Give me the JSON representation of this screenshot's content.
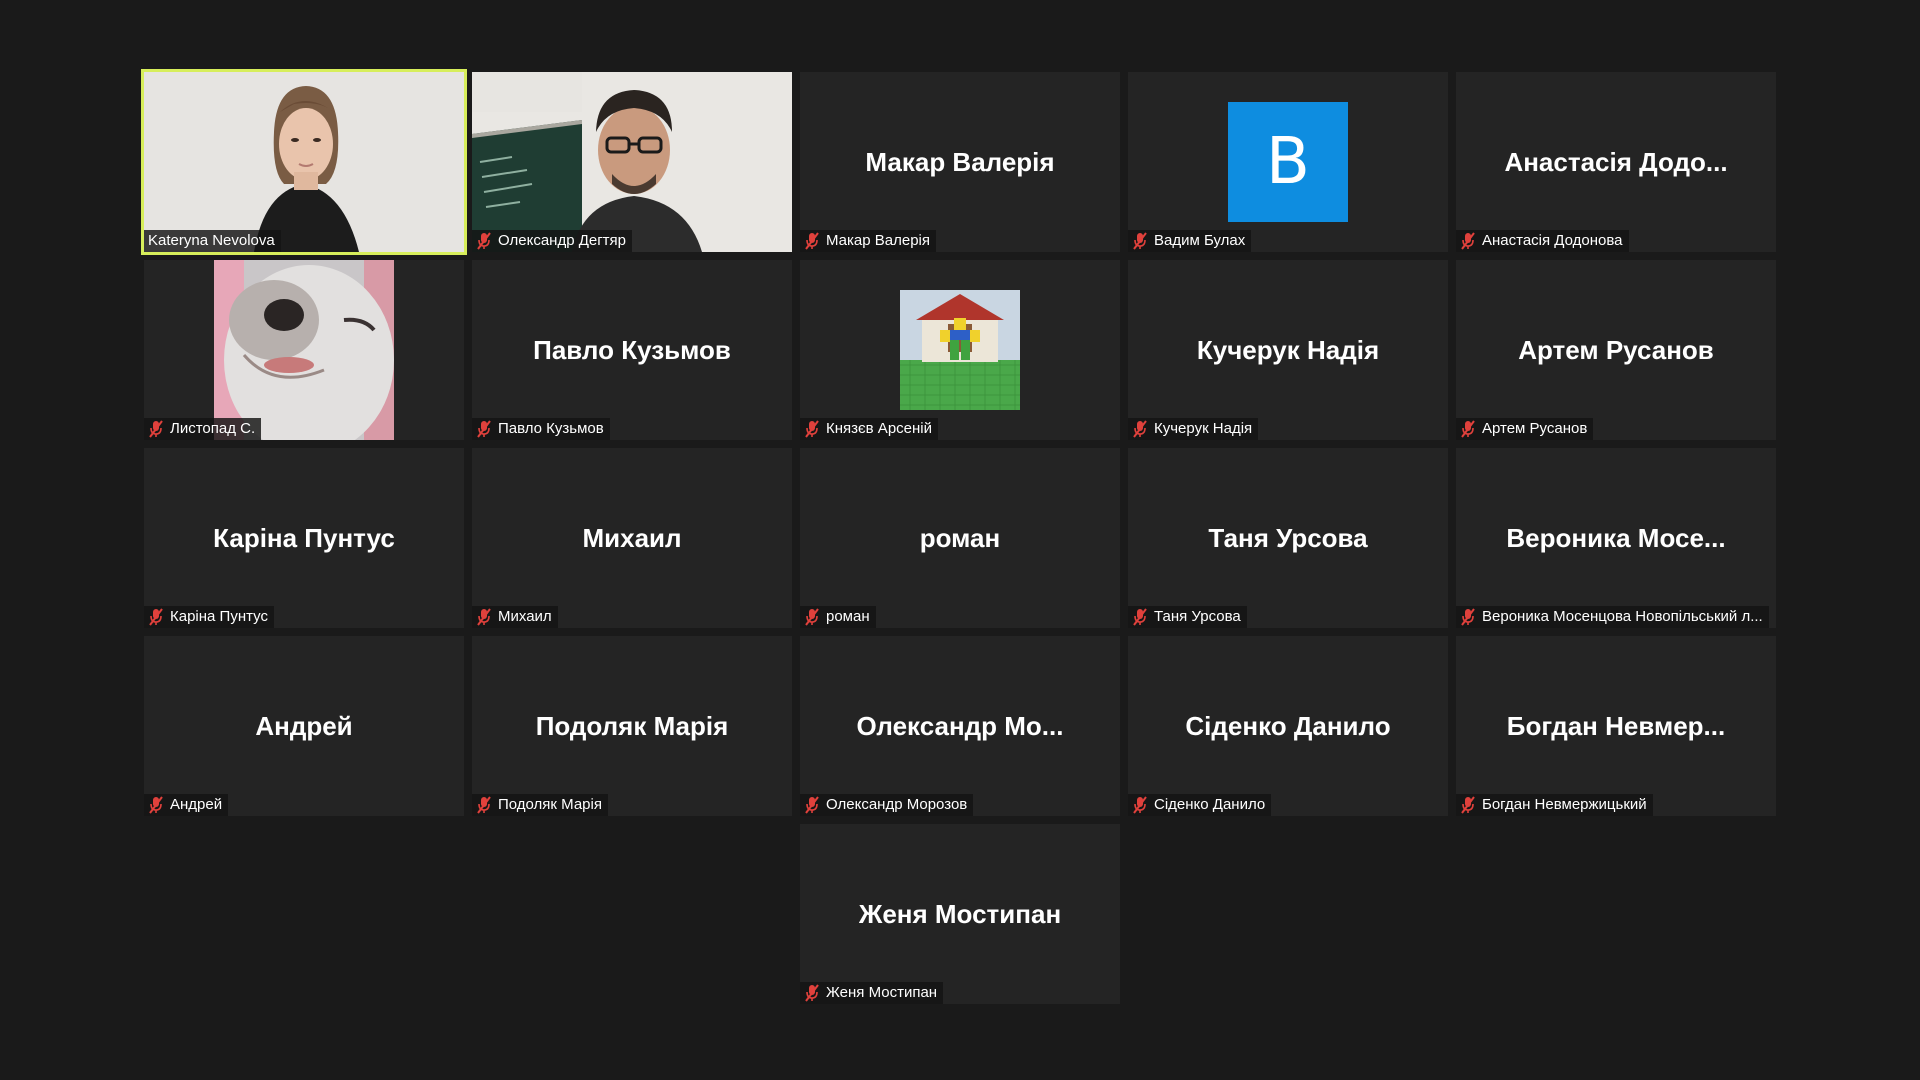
{
  "colors": {
    "background": "#1a1a1a",
    "tile": "#242424",
    "active_speaker_border": "#d7ee5b",
    "avatar_blue": "#0e8de0",
    "mic_off_red": "#e0413c"
  },
  "participants": [
    {
      "tag": "Kateryna Nevolova",
      "center": "",
      "muted": false,
      "video": "camera-woman",
      "active": true
    },
    {
      "tag": "Олександр Дегтяр",
      "center": "",
      "muted": true,
      "video": "camera-man"
    },
    {
      "tag": "Макар Валерія",
      "center": "Макар Валерія",
      "muted": true
    },
    {
      "tag": "Вадим Булах",
      "center": "",
      "muted": true,
      "avatar_letter": "B"
    },
    {
      "tag": "Анастасія Додонова",
      "center": "Анастасія Додо...",
      "muted": true
    },
    {
      "tag": "Листопад С.",
      "center": "",
      "muted": true,
      "video": "profile-dog"
    },
    {
      "tag": "Павло Кузьмов",
      "center": "Павло Кузьмов",
      "muted": true
    },
    {
      "tag": "Князєв Арсеній",
      "center": "",
      "muted": true,
      "video": "profile-game-character"
    },
    {
      "tag": "Кучерук Надія",
      "center": "Кучерук Надія",
      "muted": true
    },
    {
      "tag": "Артем Русанов",
      "center": "Артем Русанов",
      "muted": true
    },
    {
      "tag": "Каріна Пунтус",
      "center": "Каріна Пунтус",
      "muted": true
    },
    {
      "tag": "Михаил",
      "center": "Михаил",
      "muted": true
    },
    {
      "tag": "роман",
      "center": "роман",
      "muted": true
    },
    {
      "tag": "Таня Урсова",
      "center": "Таня Урсова",
      "muted": true
    },
    {
      "tag": "Вероника Мосенцова Новопільський л...",
      "center": "Вероника  Мосе...",
      "muted": true
    },
    {
      "tag": "Андрей",
      "center": "Андрей",
      "muted": true
    },
    {
      "tag": "Подоляк Марія",
      "center": "Подоляк Марія",
      "muted": true
    },
    {
      "tag": "Олександр Морозов",
      "center": "Олександр  Мо...",
      "muted": true
    },
    {
      "tag": "Сіденко Данило",
      "center": "Сіденко Данило",
      "muted": true
    },
    {
      "tag": "Богдан Невмержицький",
      "center": "Богдан  Невмер...",
      "muted": true
    },
    {
      "tag": "Женя Мостипан",
      "center": "Женя Мостипан",
      "muted": true
    }
  ]
}
